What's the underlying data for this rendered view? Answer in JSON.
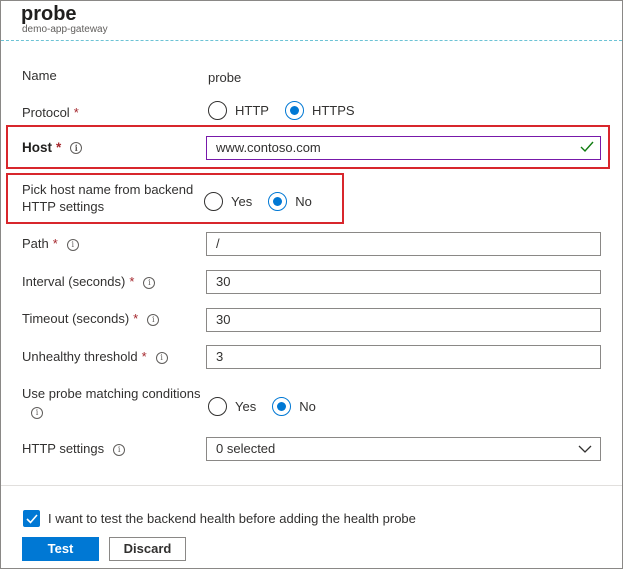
{
  "header": {
    "title": "probe",
    "subtitle": "demo-app-gateway"
  },
  "form": {
    "name": {
      "label": "Name",
      "value": "probe"
    },
    "protocol": {
      "label": "Protocol",
      "required": "*",
      "options": [
        "HTTP",
        "HTTPS"
      ],
      "selected": "HTTPS"
    },
    "host": {
      "label": "Host",
      "required": "*",
      "value": "www.contoso.com"
    },
    "pick_host": {
      "label_line1": "Pick host name from backend",
      "label_line2": "HTTP settings",
      "options": [
        "Yes",
        "No"
      ],
      "selected": "No"
    },
    "path": {
      "label": "Path",
      "required": "*",
      "value": "/"
    },
    "interval": {
      "label": "Interval (seconds)",
      "required": "*",
      "value": "30"
    },
    "timeout": {
      "label": "Timeout (seconds)",
      "required": "*",
      "value": "30"
    },
    "unhealthy": {
      "label": "Unhealthy threshold",
      "required": "*",
      "value": "3"
    },
    "matching": {
      "label": "Use probe matching conditions",
      "options": [
        "Yes",
        "No"
      ],
      "selected": "No"
    },
    "http_settings": {
      "label": "HTTP settings",
      "value": "0 selected"
    },
    "info_glyph": "i"
  },
  "footer": {
    "checkbox_label": "I want to test the backend health before adding the health probe",
    "checkbox_checked": true,
    "test_label": "Test",
    "discard_label": "Discard"
  },
  "colors": {
    "accent": "#0078d4",
    "required": "#a4262c",
    "highlight": "#d8262c",
    "valid": "#107c10"
  },
  "icons": {
    "info": "info-icon",
    "valid": "checkmark-icon",
    "dropdown": "chevron-down-icon"
  }
}
